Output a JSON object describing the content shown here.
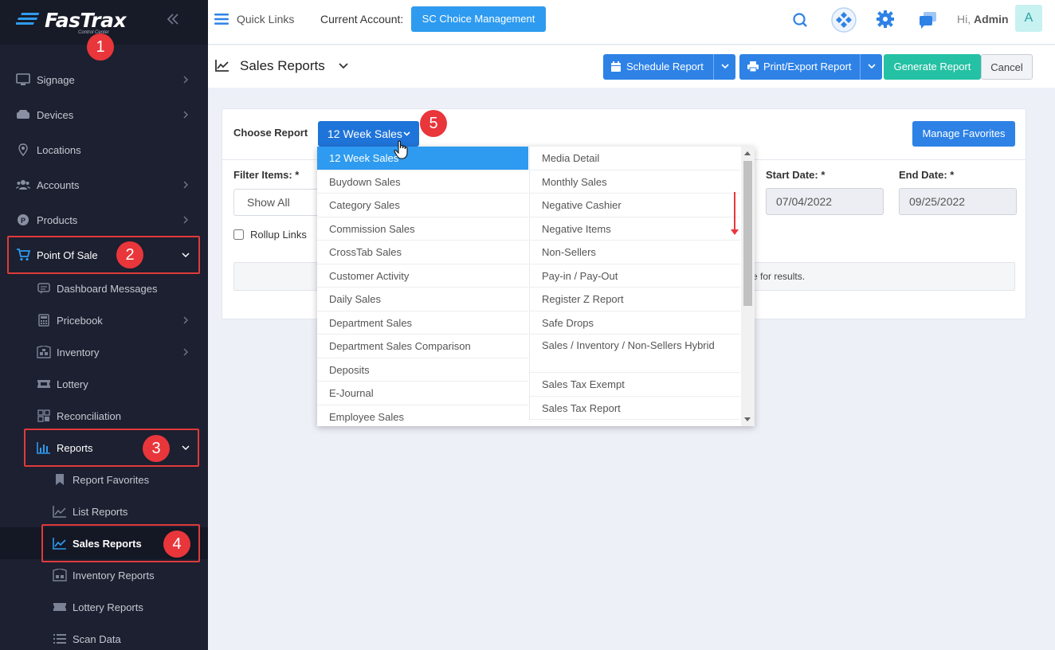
{
  "sidebar": {
    "logo_text": "FasTrax",
    "logo_sub": "Control Center",
    "items": [
      {
        "label": "Signage"
      },
      {
        "label": "Devices"
      },
      {
        "label": "Locations"
      },
      {
        "label": "Accounts"
      },
      {
        "label": "Products"
      },
      {
        "label": "Point Of Sale"
      },
      {
        "label": "Dashboard Messages"
      },
      {
        "label": "Pricebook"
      },
      {
        "label": "Inventory"
      },
      {
        "label": "Lottery"
      },
      {
        "label": "Reconciliation"
      },
      {
        "label": "Reports"
      },
      {
        "label": "Report Favorites"
      },
      {
        "label": "List Reports"
      },
      {
        "label": "Sales Reports"
      },
      {
        "label": "Inventory Reports"
      },
      {
        "label": "Lottery Reports"
      },
      {
        "label": "Scan Data"
      }
    ]
  },
  "callouts": [
    "1",
    "2",
    "3",
    "4",
    "5"
  ],
  "topbar": {
    "quick_links": "Quick Links",
    "current_account_label": "Current Account:",
    "current_account": "SC Choice Management",
    "greeting": "Hi,",
    "user": "Admin",
    "avatar_letter": "A"
  },
  "page": {
    "title": "Sales Reports",
    "schedule_btn": "Schedule Report",
    "print_btn": "Print/Export Report",
    "generate_btn": "Generate Report",
    "cancel_btn": "Cancel"
  },
  "form": {
    "choose_label": "Choose Report",
    "selected_report": "12 Week Sales",
    "manage_favorites": "Manage Favorites",
    "filter_label": "Filter Items: *",
    "filter_value": "Show All",
    "rollup_label": "Rollup Links",
    "start_label": "Start Date: *",
    "start_value": "07/04/2022",
    "end_label": "End Date: *",
    "end_value": "09/25/2022",
    "results_text": "e for results."
  },
  "dropdown": {
    "left": [
      "12 Week Sales",
      "Buydown Sales",
      "Category Sales",
      "Commission Sales",
      "CrossTab Sales",
      "Customer Activity",
      "Daily Sales",
      "Department Sales",
      "Department Sales Comparison",
      "Deposits",
      "E-Journal",
      "Employee Sales"
    ],
    "right": [
      "Media Detail",
      "Monthly Sales",
      "Negative Cashier",
      "Negative Items",
      "Non-Sellers",
      "Pay-in / Pay-Out",
      "Register Z Report",
      "Safe Drops",
      "Sales / Inventory / Non-Sellers Hybrid",
      "Sales Tax Exempt",
      "Sales Tax Report"
    ]
  },
  "colors": {
    "sidebar_bg": "#1c2030",
    "primary": "#2e82e6",
    "teal": "#25c1a4",
    "callout": "#e8363b"
  }
}
